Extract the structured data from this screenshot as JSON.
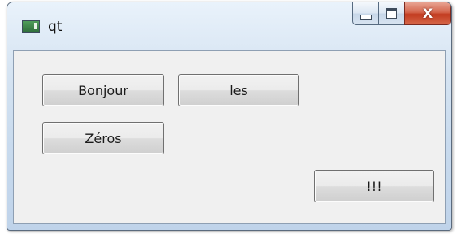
{
  "window": {
    "title": "qt"
  },
  "titlebar": {
    "app_icon": "qt-window-icon",
    "minimize_icon": "minimize-icon",
    "maximize_icon": "maximize-icon",
    "close_label": "X"
  },
  "buttons": {
    "bonjour": "Bonjour",
    "les": "les",
    "zeros": "Zéros",
    "exclaim": "!!!"
  }
}
